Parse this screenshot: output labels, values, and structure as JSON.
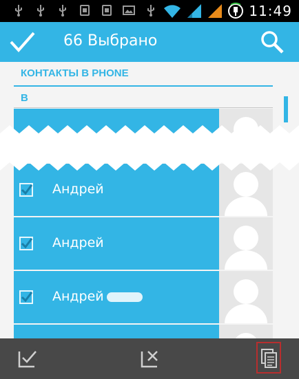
{
  "status_bar": {
    "time": "11:49",
    "icons": [
      "usb-icon",
      "usb-icon",
      "usb-icon",
      "sim-icon",
      "sim-icon",
      "image-icon",
      "usb-icon",
      "wifi-icon",
      "signal-icon",
      "signal-icon",
      "charging-icon"
    ]
  },
  "action_bar": {
    "title": "66 Выбрано",
    "done_icon": "check-icon",
    "search_icon": "search-icon"
  },
  "list": {
    "section_header": "КОНТАКТЫ В PHONE",
    "letter_header": "В",
    "contacts": [
      {
        "name": "Андрей",
        "checked": true
      },
      {
        "name": "Андрей",
        "checked": true
      },
      {
        "name": "Андрей",
        "checked": true
      }
    ]
  },
  "bottom_bar": {
    "buttons": [
      "select-all-icon",
      "deselect-all-icon",
      "copy-icon"
    ]
  },
  "colors": {
    "accent": "#33b5e5",
    "bottom_bar": "#484848",
    "status_bar": "#000000",
    "highlight": "#b82e2e"
  }
}
